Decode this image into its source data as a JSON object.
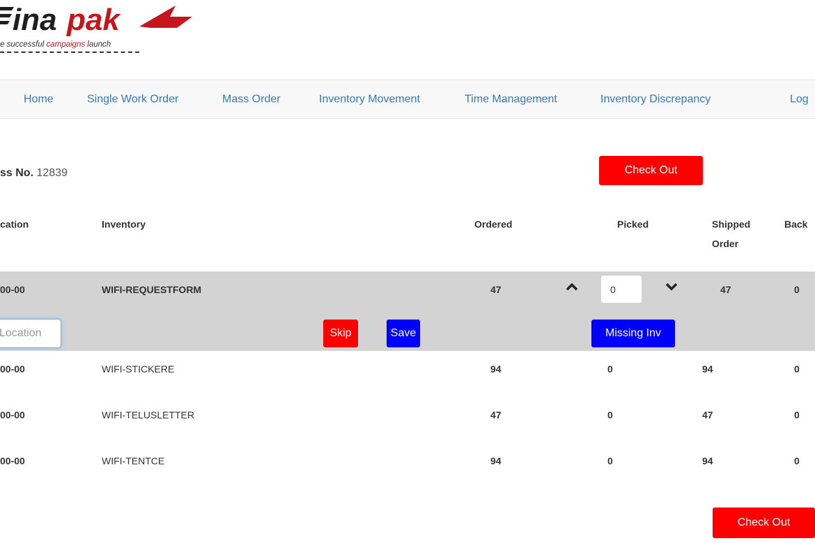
{
  "logo": {
    "wordmark_left": "ina",
    "wordmark_right": "pak",
    "tagline_prefix": "e successful ",
    "tagline_emphasis": "campaigns",
    "tagline_suffix": " launch",
    "colors": {
      "dark": "#1f1f1f",
      "red": "#c4161c"
    }
  },
  "nav": {
    "items": [
      "Home",
      "Single Work Order",
      "Mass Order",
      "Inventory Movement",
      "Time Management",
      "Inventory Discrepancy",
      "Log"
    ]
  },
  "order": {
    "mass_label": "ss No.",
    "mass_number": "12839",
    "checkout_label": "Check Out"
  },
  "table": {
    "headers": {
      "location": "cation",
      "inventory": "Inventory",
      "ordered": "Ordered",
      "picked": "Picked",
      "shipped": "Shipped",
      "back": "Back",
      "order": "Order"
    },
    "active_row": {
      "location": "00-00",
      "inventory": "WIFI-REQUESTFORM",
      "ordered": "47",
      "picked_value": "0",
      "shipped": "47",
      "back": "0",
      "location_placeholder": "Location",
      "skip_label": "Skip",
      "save_label": "Save",
      "missing_label": "Missing Inv"
    },
    "rows": [
      {
        "location": "00-00",
        "inventory": "WIFI-STICKERE",
        "ordered": "94",
        "picked": "0",
        "shipped": "94",
        "back": "0"
      },
      {
        "location": "00-00",
        "inventory": "WIFI-TELUSLETTER",
        "ordered": "47",
        "picked": "0",
        "shipped": "47",
        "back": "0"
      },
      {
        "location": "00-00",
        "inventory": "WIFI-TENTCE",
        "ordered": "94",
        "picked": "0",
        "shipped": "94",
        "back": "0"
      }
    ]
  },
  "colors": {
    "link": "#337ab7",
    "danger": "#ff0000",
    "primary": "#0000ff",
    "active_row_bg": "#d3d3d3"
  }
}
